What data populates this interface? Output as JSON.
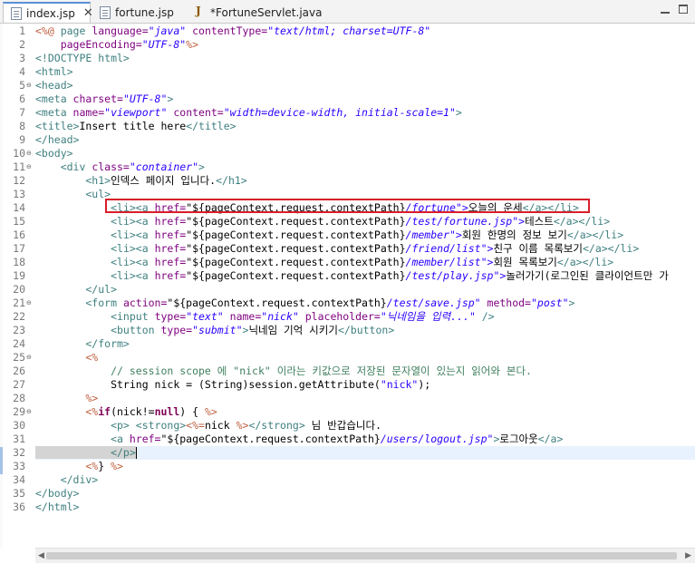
{
  "tabs": [
    {
      "label": "index.jsp",
      "active": true,
      "close": "✕"
    },
    {
      "label": "fortune.jsp",
      "active": false
    },
    {
      "label": "*FortuneServlet.java",
      "active": false
    }
  ],
  "window_controls": {
    "minimize": "",
    "maximize": ""
  },
  "line_numbers": [
    "1",
    "2",
    "3",
    "4",
    "5",
    "6",
    "7",
    "8",
    "9",
    "10",
    "11",
    "12",
    "13",
    "14",
    "15",
    "16",
    "17",
    "18",
    "19",
    "20",
    "21",
    "22",
    "23",
    "24",
    "25",
    "26",
    "27",
    "28",
    "29",
    "30",
    "31",
    "32",
    "33",
    "34",
    "35",
    "36"
  ],
  "fold_markers": {
    "5": "⊖",
    "10": "⊖",
    "11": "⊖",
    "21": "⊖",
    "25": "⊖",
    "29": "⊖"
  },
  "code": {
    "l1a": "<%@ ",
    "l1b": "page ",
    "l1c": "language=",
    "l1d": "\"java\"",
    "l1e": " contentType=",
    "l1f": "\"text/html; charset=UTF-8\"",
    "l2a": "    pageEncoding=",
    "l2b": "\"UTF-8\"",
    "l2c": "%>",
    "l3": "<!DOCTYPE html>",
    "l4": "<html>",
    "l5": "<head>",
    "l6a": "<meta ",
    "l6b": "charset=",
    "l6c": "\"UTF-8\"",
    "l6d": ">",
    "l7a": "<meta ",
    "l7b": "name=",
    "l7c": "\"viewport\"",
    "l7d": " content=",
    "l7e": "\"width=device-width, initial-scale=1\"",
    "l7f": ">",
    "l8a": "<title>",
    "l8b": "Insert title here",
    "l8c": "</title>",
    "l9": "</head>",
    "l10": "<body>",
    "l11a": "    <div ",
    "l11b": "class=",
    "l11c": "\"container\"",
    "l11d": ">",
    "l12a": "        <h1>",
    "l12b": "인덱스 페이지 입니다.",
    "l12c": "</h1>",
    "l13": "        <ul>",
    "li_open": "<li><a ",
    "href": "href=",
    "el": "\"${pageContext.request.contextPath}",
    "l14_path": "/fortune",
    "l14_text": "오늘의 운세",
    "l15_path": "/test/fortune.jsp",
    "l15_text": "테스트",
    "l16_path": "/member",
    "l16_text": "회원 한명의 정보 보기",
    "l17_path": "/friend/list",
    "l17_text": "친구 이름 목록보기",
    "l18_path": "/member/list",
    "l18_text": "회원 목록보기",
    "l19_path": "/test/play.jsp",
    "l19_text": "놀러가기(로그인된 클라이언트만 가",
    "li_close": "</a></li>",
    "quote_close": "\">",
    "l20": "        </ul>",
    "l21a": "        <form ",
    "l21b": "action=",
    "l21c": "\"${pageContext.request.contextPath}",
    "l21d": "/test/save.jsp\"",
    "l21e": " method=",
    "l21f": "\"post\"",
    "l21g": ">",
    "l22a": "            <input ",
    "l22b": "type=",
    "l22c": "\"text\"",
    "l22d": " name=",
    "l22e": "\"nick\"",
    "l22f": " placeholder=",
    "l22g": "\"닉네임을 입력...\"",
    "l22h": " />",
    "l23a": "            <button ",
    "l23b": "type=",
    "l23c": "\"submit\"",
    "l23d": ">",
    "l23e": "닉네임 기억 시키기",
    "l23f": "</button>",
    "l24": "        </form>",
    "l25": "        <%",
    "l26": "            // session scope 에 \"nick\" 이라는 키값으로 저장된 문자열이 있는지 읽어와 본다.",
    "l27a": "            String nick = (String)session.getAttribute(",
    "l27b": "\"nick\"",
    "l27c": ");",
    "l28": "        %>",
    "l29a": "        <%",
    "l29b": "if",
    "l29c": "(nick!=",
    "l29d": "null",
    "l29e": ") { ",
    "l29f": "%>",
    "l30a": "            <p> <strong>",
    "l30b": "<%=",
    "l30c": "nick ",
    "l30d": "%>",
    "l30e": "</strong>",
    "l30f": " 님 반갑습니다.",
    "l31a": "            <a ",
    "l31b": "href=",
    "l31c": "\"${pageContext.request.contextPath}",
    "l31d": "/users/logout.jsp\"",
    "l31e": ">",
    "l31f": "로그아웃",
    "l31g": "</a>",
    "l32": "            </p>",
    "l33a": "        <%",
    "l33b": "} ",
    "l33c": "%>",
    "l34": "    </div>",
    "l35": "</body>",
    "l36": "</html>"
  },
  "colors": {
    "tag": "#3f7f7f",
    "attribute": "#7f007f",
    "string": "#2a00ff",
    "jsp_delimiter": "#bf5f3f",
    "keyword": "#7f0055",
    "comment": "#3f7f5f",
    "highlight_box": "#d81e2a",
    "current_line": "#e8f2fe"
  },
  "icons": {
    "jsp_file": "file-icon",
    "java_file": "java-file-icon",
    "close": "close-icon"
  },
  "scrollbar": {
    "left_arrow": "◀",
    "right_arrow": "▶"
  }
}
